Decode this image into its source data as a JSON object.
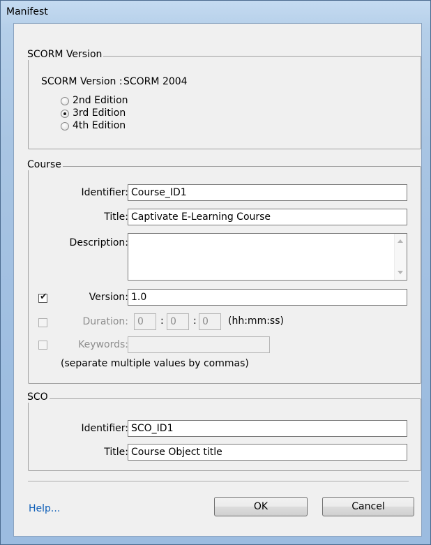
{
  "window": {
    "title": "Manifest"
  },
  "scorm": {
    "group_label": "SCORM Version",
    "version_label": "SCORM Version :",
    "version_value": "SCORM 2004",
    "editions": [
      {
        "label": "2nd Edition",
        "selected": false
      },
      {
        "label": "3rd Edition",
        "selected": true
      },
      {
        "label": "4th Edition",
        "selected": false
      }
    ]
  },
  "course": {
    "group_label": "Course",
    "identifier_label": "Identifier:",
    "identifier_value": "Course_ID1",
    "title_label": "Title:",
    "title_value": "Captivate E-Learning Course",
    "description_label": "Description:",
    "description_value": "",
    "version_label": "Version:",
    "version_value": "1.0",
    "version_checked": true,
    "duration_label": "Duration:",
    "duration_hh": "0",
    "duration_mm": "0",
    "duration_ss": "0",
    "duration_sep": ":",
    "duration_format": "(hh:mm:ss)",
    "duration_checked": false,
    "keywords_label": "Keywords:",
    "keywords_value": "",
    "keywords_checked": false,
    "keywords_hint": "(separate multiple values by commas)"
  },
  "sco": {
    "group_label": "SCO",
    "identifier_label": "Identifier:",
    "identifier_value": "SCO_ID1",
    "title_label": "Title:",
    "title_value": "Course Object title"
  },
  "footer": {
    "help_link": "Help...",
    "ok_label": "OK",
    "cancel_label": "Cancel"
  },
  "colors": {
    "link": "#0f5fb8",
    "frame": "#a9c5e3",
    "dialog_bg": "#f0f0f0"
  },
  "icons": {
    "check": "checkmark-icon",
    "scroll_up": "scroll-up-icon",
    "scroll_down": "scroll-down-icon"
  }
}
